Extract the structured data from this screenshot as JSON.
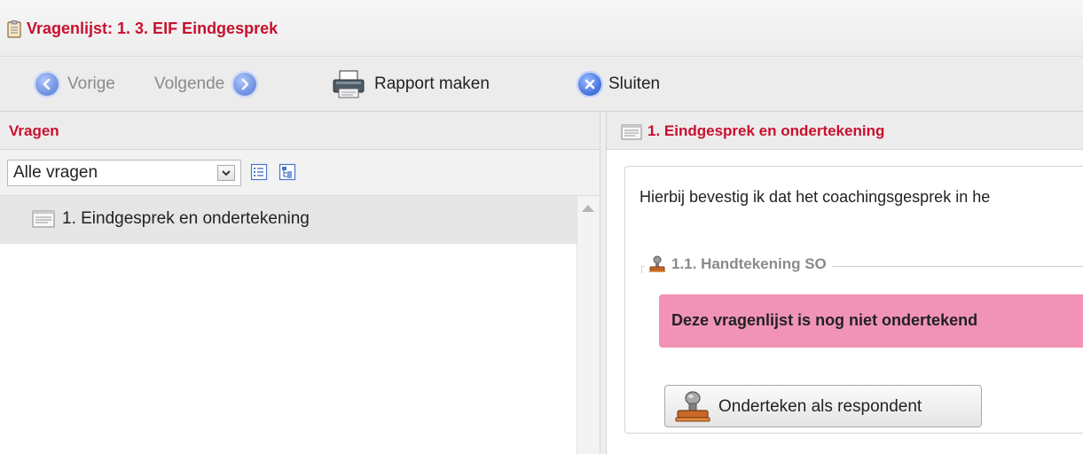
{
  "window": {
    "title": "Vragenlijst: 1. 3. EIF Eindgesprek",
    "title_icon": "clipboard-icon"
  },
  "toolbar": {
    "prev_label": "Vorige",
    "next_label": "Volgende",
    "report_label": "Rapport maken",
    "close_label": "Sluiten",
    "icons": [
      "arrow-left-icon",
      "arrow-right-icon",
      "printer-icon",
      "close-icon"
    ]
  },
  "left_panel": {
    "header": "Vragen",
    "filter": {
      "selected": "Alle vragen",
      "icons": [
        "list-view-icon",
        "tree-view-icon"
      ]
    },
    "tree": [
      {
        "label": "1. Eindgesprek en ondertekening",
        "icon": "document-icon",
        "selected": true
      }
    ]
  },
  "right_panel": {
    "header": "1. Eindgesprek en ondertekening",
    "header_icon": "document-icon",
    "question_text": "Hierbij bevestig ik dat het coachingsgesprek in he",
    "section": {
      "legend": "1.1. Handtekening SO",
      "legend_icon": "stamp-icon",
      "warning": "Deze vragenlijst is nog niet ondertekend",
      "sign_button": "Onderteken als respondent",
      "sign_button_icon": "stamp-icon"
    }
  },
  "colors": {
    "accent_red": "#c8102e",
    "warning_pink": "#f193b6",
    "toolbar_blue": "#4b78e0"
  }
}
